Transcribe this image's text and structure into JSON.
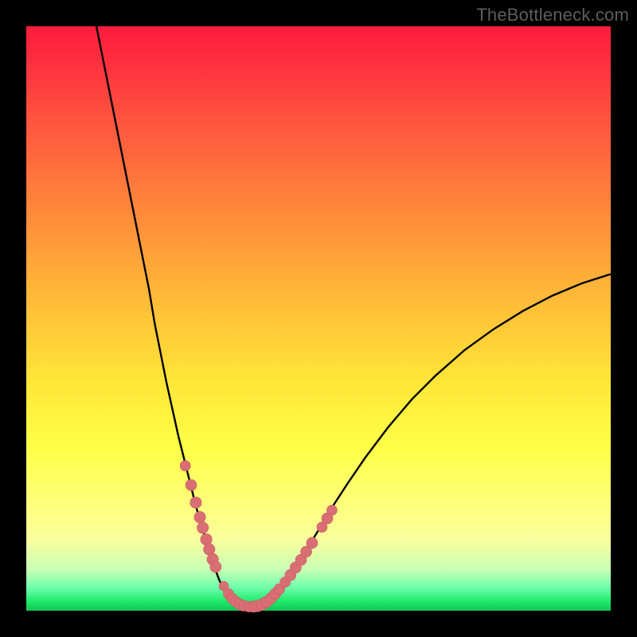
{
  "watermark": "TheBottleneck.com",
  "colors": {
    "background": "#000000",
    "curve_stroke": "#000000",
    "marker_fill": "#d96f74",
    "marker_stroke": "#c85a60"
  },
  "chart_data": {
    "type": "line",
    "title": "",
    "xlabel": "",
    "ylabel": "",
    "xlim": [
      0,
      100
    ],
    "ylim": [
      0,
      100
    ],
    "grid": false,
    "series": [
      {
        "name": "curve",
        "x": [
          12,
          13,
          14,
          15,
          16,
          17,
          18,
          19,
          20,
          21,
          22,
          23,
          24,
          25,
          26,
          27,
          28,
          29,
          30,
          31,
          32,
          33,
          34,
          35,
          36,
          37,
          38,
          40,
          42,
          44,
          46,
          48,
          50,
          52,
          55,
          58,
          62,
          66,
          70,
          75,
          80,
          85,
          90,
          95,
          100
        ],
        "y": [
          100,
          95,
          90,
          85,
          80,
          75,
          70,
          65,
          60,
          55,
          49,
          44,
          39,
          34.5,
          30,
          26,
          22,
          18,
          14.5,
          11,
          8,
          5.3,
          3.2,
          1.8,
          1.0,
          0.6,
          0.6,
          1.0,
          2.4,
          4.6,
          7.4,
          10.5,
          13.8,
          17.2,
          21.8,
          26.2,
          31.5,
          36.2,
          40.2,
          44.6,
          48.2,
          51.3,
          53.9,
          56.0,
          57.6
        ]
      }
    ],
    "markers": {
      "name": "dot-markers",
      "x": [
        27.2,
        28.2,
        29.0,
        29.7,
        30.2,
        30.8,
        31.3,
        31.9,
        32.4,
        33.8,
        34.6,
        35.2,
        35.9,
        36.5,
        37.2,
        38.1,
        38.9,
        39.6,
        40.3,
        41.1,
        41.9,
        42.6,
        43.3,
        44.3,
        45.2,
        46.1,
        47.0,
        47.9,
        48.9,
        50.6,
        51.5,
        52.3
      ],
      "y": [
        24.8,
        21.5,
        18.5,
        16.0,
        14.2,
        12.2,
        10.5,
        8.8,
        7.5,
        4.2,
        2.9,
        2.1,
        1.5,
        1.1,
        0.85,
        0.7,
        0.7,
        0.8,
        1.05,
        1.5,
        2.15,
        2.9,
        3.7,
        4.9,
        6.1,
        7.4,
        8.7,
        10.1,
        11.6,
        14.3,
        15.8,
        17.2
      ],
      "r": [
        6.5,
        7.0,
        7.2,
        7.2,
        7.2,
        7.2,
        7.2,
        7.2,
        7.0,
        6.0,
        6.5,
        6.8,
        6.8,
        6.8,
        6.8,
        6.8,
        7.2,
        7.2,
        7.2,
        7.2,
        7.0,
        7.0,
        6.8,
        6.5,
        7.0,
        7.0,
        7.0,
        7.0,
        7.0,
        6.5,
        7.0,
        6.5
      ]
    }
  }
}
